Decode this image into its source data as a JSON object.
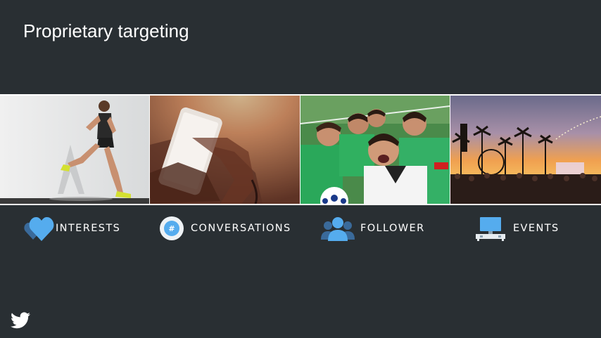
{
  "slide": {
    "title": "Proprietary targeting"
  },
  "photos": [
    {
      "icon": "runner-photo"
    },
    {
      "icon": "phone-in-hand-photo"
    },
    {
      "icon": "soccer-friends-selfie-photo"
    },
    {
      "icon": "festival-sunset-photo"
    }
  ],
  "categories": [
    {
      "label": "INTERESTS",
      "icon": "heart-icon"
    },
    {
      "label": "CONVERSATIONS",
      "icon": "hashtag-icon"
    },
    {
      "label": "FOLLOWER",
      "icon": "people-icon"
    },
    {
      "label": "EVENTS",
      "icon": "tv-icon"
    }
  ],
  "colors": {
    "background": "#292f33",
    "accent": "#55acee",
    "text": "#ffffff"
  },
  "logo": {
    "icon": "twitter-bird-icon"
  }
}
